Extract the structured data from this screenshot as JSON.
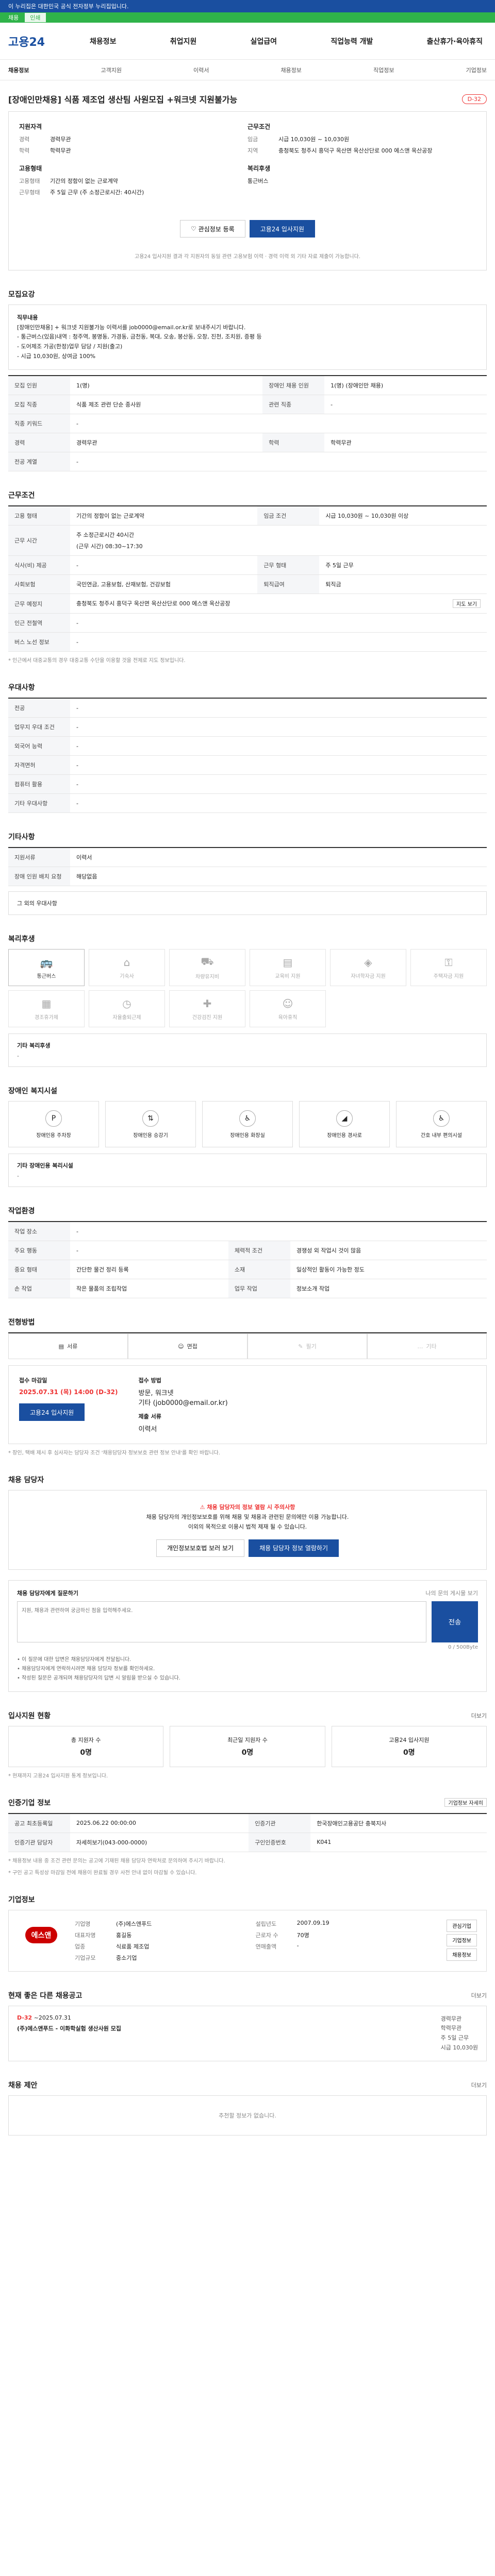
{
  "topbar": {
    "text": "이 누리집은 대한민국 공식 전자정부 누리집입니다."
  },
  "greenbar": {
    "label": "채용",
    "box": "인쇄"
  },
  "header": {
    "logo": "고용24",
    "gnb": [
      "채용정보",
      "취업지원",
      "실업급여",
      "직업능력 개발",
      "출산휴가·육아휴직"
    ]
  },
  "subnav": [
    "채용정보",
    "고객지원",
    "이력서",
    "채용정보",
    "직업정보",
    "기업정보"
  ],
  "job": {
    "title": "[장애인만채용] 식품 제조업 생산팀 사원모집 +워크넷 지원불가능",
    "dday": "D-32"
  },
  "summary": {
    "left_title": "지원자격",
    "left": [
      {
        "k": "경력",
        "v": "경력무관"
      },
      {
        "k": "학력",
        "v": "학력무관"
      }
    ],
    "left2_title": "고용형태",
    "left2": [
      {
        "k": "고용형태",
        "v": "기간의 정함이 없는 근로계약"
      },
      {
        "k": "근무형태",
        "v": "주 5일 근무 (주 소정근로시간: 40시간)"
      }
    ],
    "right_title": "근무조건",
    "right": [
      {
        "k": "임금",
        "v": "시급 10,030원 ~ 10,030원"
      },
      {
        "k": "지역",
        "v": "충청북도 청주시 흥덕구 옥산면 옥산산단로 000 에스앤 옥산공장"
      }
    ],
    "right2_title": "복리후생",
    "right2": [
      {
        "k": "",
        "v": "통근버스"
      }
    ],
    "notice": "고용24 입사지원 결과 각 지원자의 동일 관련 고용보험 이력 · 경력 이력 외 기타 자료 제출이 가능합니다.",
    "btn_scrap": "관심정보 등록",
    "btn_apply": "고용24 입사지원"
  },
  "recruit": {
    "title": "모집요강",
    "detail_head": "직무내용",
    "detail_lines": [
      "[장애인만채용] + 워크넷 지원불가능 이력서를 job0000@email.or.kr로 보내주시기 바랍니다.",
      "- 통근버스(있음)내역 : 청주역, 봉명동, 가경동, 금천동, 복대, 오송, 봉산동, 오창, 진천, 조치원, 증평 등",
      "- 도어제조 가공(한정)업무 담당 / 지원(출고)",
      "- 시급 10,030원, 상여금 100%"
    ],
    "rows": [
      {
        "k1": "모집 인원",
        "v1": "1(명)",
        "k2": "장애인 채용 인원",
        "v2": "1(명) (장애인만 채용)"
      },
      {
        "k1": "모집 직종",
        "v1": "식품 제조 관련 단순 종사원",
        "k2": "관련 직종",
        "v2": "-"
      },
      {
        "k1": "직종 키워드",
        "v1": "-",
        "k2": "",
        "v2": ""
      },
      {
        "k1": "경력",
        "v1": "경력무관",
        "k2": "학력",
        "v2": "학력무관"
      },
      {
        "k1": "전공 계열",
        "v1": "-",
        "k2": "",
        "v2": ""
      }
    ]
  },
  "conditions": {
    "title": "근무조건",
    "r1": {
      "k1": "고용 형태",
      "v1": "기간의 정함이 없는 근로계약",
      "k2": "임금 조건",
      "v2": "시급 10,030원 ~ 10,030원 이상"
    },
    "r2": {
      "k": "근무 시간",
      "v": "주 소정근로시간 40시간",
      "v2": "(근무 시간) 08:30~17:30"
    },
    "r3": {
      "k1": "식사(비) 제공",
      "v1": "-",
      "k2": "근무 형태",
      "v2": "주 5일 근무"
    },
    "r4": {
      "k1": "사회보험",
      "v1": "국민연금, 고용보험, 산재보험, 건강보험",
      "k2": "퇴직급여",
      "v2": "퇴직금"
    },
    "r5": {
      "k": "근무 예정지",
      "v": "충청북도 청주시 흥덕구 옥산면 옥산산단로 000 에스앤 옥산공장",
      "btn": "지도 보기"
    },
    "r6": {
      "k": "인근 전철역",
      "v": "-"
    },
    "r7": {
      "k": "버스 노선 정보",
      "v": "-"
    },
    "note": "* 인근에서 대중교통의 경우 대중교통 수단을 이용할 것을 전제로 지도 정보입니다."
  },
  "preferred": {
    "title": "우대사항",
    "rows": [
      {
        "k": "전공",
        "v": "-"
      },
      {
        "k": "업무지 우대 조건",
        "v": "-"
      },
      {
        "k": "외국어 능력",
        "v": "-"
      },
      {
        "k": "자격면허",
        "v": "-"
      },
      {
        "k": "컴퓨터 활용",
        "v": "-"
      },
      {
        "k": "기타 우대사항",
        "v": "-"
      }
    ]
  },
  "other": {
    "title": "기타사항",
    "rows": [
      {
        "k": "지원서류",
        "v": "이력서"
      },
      {
        "k": "장애 인원 배치 요청",
        "v": "해당없음"
      }
    ],
    "link": "그 외의 우대사항"
  },
  "welfare": {
    "title": "복리후생",
    "items": [
      {
        "label": "통근버스",
        "on": true
      },
      {
        "label": "기숙사",
        "on": false
      },
      {
        "label": "차량유지비",
        "on": false
      },
      {
        "label": "교육비 지원",
        "on": false
      },
      {
        "label": "자녀학자금 지원",
        "on": false
      },
      {
        "label": "주택자금 지원",
        "on": false
      },
      {
        "label": "경조휴가제",
        "on": false
      },
      {
        "label": "자율출퇴근제",
        "on": false
      },
      {
        "label": "건강검진 지원",
        "on": false
      },
      {
        "label": "육아휴직",
        "on": false
      }
    ],
    "box_title": "기타 복리후생",
    "box_text": "-"
  },
  "disabled": {
    "title": "장애인 복지시설",
    "items": [
      "장애인용 주차장",
      "장애인용 승강기",
      "장애인용 화장실",
      "장애인용 경사로",
      "간호 내부 편의시설"
    ],
    "box_title": "기타 장애인용 복리시설",
    "box_text": "-"
  },
  "workplace": {
    "title": "작업환경",
    "rows": [
      {
        "k1": "작업 장소",
        "v1": "-",
        "k2": "",
        "v2": ""
      },
      {
        "k1": "주요 행동",
        "v1": "-",
        "k2": "체력적 조건",
        "v2": "경쟁성 외 작업시 것이 많음"
      },
      {
        "k1": "중요 형태",
        "v1": "간단한 물건 정리 등록",
        "k2": "소재",
        "v2": "일상적인 활동이 가능한 정도"
      },
      {
        "k1": "손 작업",
        "v1": "작은 물품의 조립작업",
        "k2": "업무 작업",
        "v2": "정보소개 작업"
      }
    ]
  },
  "method": {
    "title": "전형방법",
    "tabs": [
      {
        "label": "서류",
        "on": true
      },
      {
        "label": "면접",
        "on": true
      },
      {
        "label": "필기",
        "on": false
      },
      {
        "label": "기타",
        "on": false
      }
    ],
    "deadline_title": "접수 마감일",
    "deadline": "2025.07.31 (목) 14:00",
    "deadline_sub": "(D-32)",
    "way_title": "접수 방법",
    "way": [
      "방문, 워크넷",
      "기타 (job0000@email.or.kr)"
    ],
    "docs_title": "제출 서류",
    "docs": "이력서",
    "btn_apply": "고용24 입사지원",
    "note": "* 장인, 택배 제시 후 심사자는 담당자 조건 '채용담당자 정보보호 관련 정보 안내'를 확인 바랍니다."
  },
  "contact": {
    "title": "채용 담당자",
    "warn": "채용 담당자의 정보 열람 시 주의사항",
    "text1": "채용 담당자의 개인정보보호를 위해 채용 및 채용과 관련된 문의에만 이용 가능합니다.",
    "text2": "이외의 목적으로 이용시 법적 제재 될 수 있습니다.",
    "btn1": "개인정보보호법 보러 보기",
    "btn2": "채용 담당자 정보 열람하기"
  },
  "qa": {
    "title": "채용 담당자에게 질문하기",
    "meta": "나의 문의 게시물 보기",
    "placeholder": "지원, 채용과 관련하여 궁금하신 점을 입력해주세요.",
    "count": "0 / 500Byte",
    "btn": "전송",
    "notes": [
      "• 이 질문에 대한 답변은 채용담당자에게 전달됩니다.",
      "• 채용담당자에게 연락하시려면 채용 담당자 정보를 확인하세요.",
      "• 작성된 질문은 공개되며 채용담당자의 답변 시 알림을 받으실 수 있습니다."
    ]
  },
  "stats": {
    "title": "입사지원 현황",
    "more": "더보기",
    "items": [
      {
        "label": "총 지원자 수",
        "n": "0명"
      },
      {
        "label": "최근일 지원자 수",
        "n": "0명"
      },
      {
        "label": "고용24 입사지원",
        "n": "0명"
      }
    ],
    "note": "* 현재까지 고용24 입사지원 통계 정보입니다."
  },
  "posting": {
    "title": "인증기업 정보",
    "btn": "기업정보 자세히",
    "rows": [
      {
        "k1": "공고 최초등록일",
        "v1": "2025.06.22 00:00:00",
        "k2": "인증기관",
        "v2": "한국장애인고용공단 충북지사"
      },
      {
        "k1": "인증기관 담당자",
        "v1": "자세히보기(043-000-0000)",
        "k2": "구인인증번호",
        "v2": "K041"
      }
    ],
    "notes": [
      "* 채용정보 내용 중 조건 관련 문의는 공고에 기재된 채용 담당자 연락처로 문의하여 주시기 바랍니다.",
      "* 구인 공고 특성상 마감일 전에 채용이 완료될 경우 사전 안내 없이 마감될 수 있습니다."
    ]
  },
  "company": {
    "title": "기업정보",
    "logo": "에스앤",
    "rows": [
      {
        "k1": "기업명",
        "v1": "(주)에스앤푸드",
        "k2": "설립년도",
        "v2": "2007.09.19"
      },
      {
        "k1": "대표자명",
        "v1": "홍길동",
        "k2": "근로자 수",
        "v2": "70명"
      },
      {
        "k1": "업종",
        "v1": "식료품 제조업",
        "k2": "연매출액",
        "v2": "-"
      },
      {
        "k1": "기업규모",
        "v1": "중소기업",
        "k2": "",
        "v2": ""
      }
    ],
    "btns": [
      "관심기업",
      "기업정보",
      "채용정보"
    ]
  },
  "other_job": {
    "title": "현재 좋은 다른 채용공고",
    "more": "더보기",
    "badge": "D-32",
    "date": "~2025.07.31",
    "name": "(주)에스앤푸드 - 이화학실험 생산사원 모집",
    "specs": [
      "경력무관",
      "학력무관",
      "주 5일 근무",
      "시급 10,030원"
    ]
  },
  "similar": {
    "title": "채용 제안",
    "more": "더보기",
    "empty": "추천할 정보가 없습니다."
  }
}
